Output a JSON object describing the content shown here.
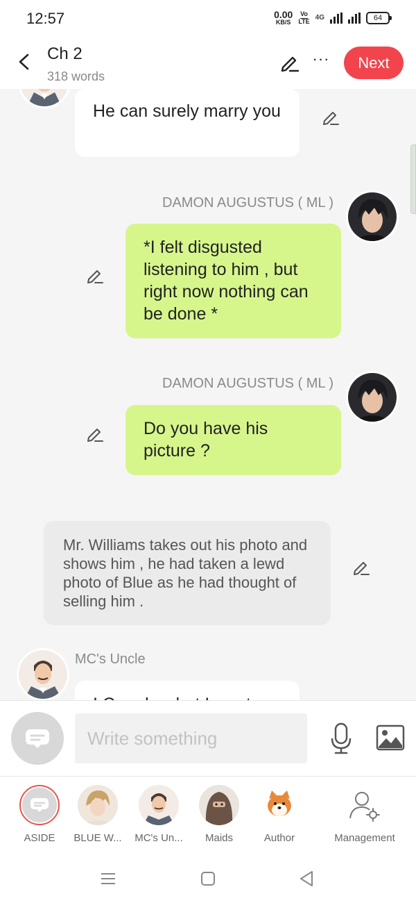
{
  "status_bar": {
    "time": "12:57",
    "net_speed_value": "0.00",
    "net_speed_unit": "KB/S",
    "volte_top": "Vo",
    "volte_bottom": "LTE",
    "network_type": "4G",
    "battery": "64"
  },
  "header": {
    "title": "Ch 2",
    "word_count": "318 words",
    "more_label": "···",
    "next_label": "Next",
    "accent_color": "#f2444c"
  },
  "messages": [
    {
      "type": "left",
      "text": "He can surely marry you"
    },
    {
      "type": "right",
      "sender": "DAMON AUGUSTUS ( ML )",
      "text": "*I felt disgusted listening to him , but right now nothing can be done *"
    },
    {
      "type": "right",
      "sender": "DAMON AUGUSTUS ( ML )",
      "text": "Do you have his picture ?"
    },
    {
      "type": "aside",
      "text": "Mr. Williams takes out his photo and shows him  , he had taken a lewd photo of Blue as he had thought of selling him ."
    },
    {
      "type": "left",
      "sender": "MC's Uncle",
      "text": "I Can do what I want"
    }
  ],
  "input": {
    "placeholder": "Write something",
    "value": ""
  },
  "characters": [
    {
      "label": "ASIDE",
      "icon": "aside-icon",
      "selected": true
    },
    {
      "label": "BLUE W...",
      "icon": "blue-avatar"
    },
    {
      "label": "MC's Un...",
      "icon": "uncle-avatar"
    },
    {
      "label": "Maids",
      "icon": "maid-avatar"
    },
    {
      "label": "Author",
      "icon": "shiba-avatar"
    },
    {
      "label": "Management",
      "icon": "user-gear-icon"
    }
  ],
  "colors": {
    "bubble_green": "#d6f68c",
    "bubble_white": "#ffffff",
    "bubble_aside": "#ebebeb"
  }
}
